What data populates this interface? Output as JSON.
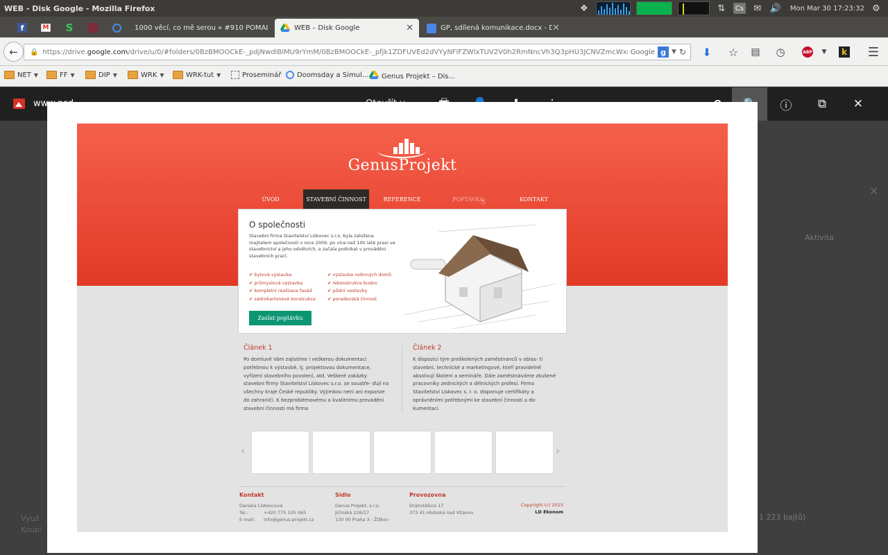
{
  "os_bar": {
    "window_title": "WEB - Disk Google - Mozilla Firefox",
    "clock": "Mon Mar 30 17:23:32",
    "cs_label": "Cs"
  },
  "tabs": [
    {
      "label": "1000 věcí, co mě serou » #910 POMALÁ ..."
    },
    {
      "label": "WEB – Disk Google"
    },
    {
      "label": "GP, sdílená komunikace.docx - Do..."
    }
  ],
  "url": {
    "prefix": "https://drive.",
    "domain": "google.com",
    "rest": "/drive/u/0/#folders/0BzBMOOCkE-_pdjNwdlBIMU9rYmM/0BzBMOOCkE-_pfjk1ZDFUVEd2dVYyNFlFZWlxTUV2V0h2RmNncVh3Q3pHU3JCNVZmcWxrR2s/0B9dngUYRv1HARV",
    "search_engine": "Google"
  },
  "bookmarks": [
    {
      "label": "NET",
      "type": "folder"
    },
    {
      "label": "FF",
      "type": "folder"
    },
    {
      "label": "DIP",
      "type": "folder"
    },
    {
      "label": "WRK",
      "type": "folder"
    },
    {
      "label": "WRK-tut",
      "type": "folder"
    },
    {
      "label": "Proseminář",
      "type": "page"
    },
    {
      "label": "Doomsday a Simul...",
      "type": "page"
    },
    {
      "label": "Genus Projekt – Dis...",
      "type": "page"
    }
  ],
  "viewer": {
    "file_name": "www.psd",
    "open_with": "Otevřít v",
    "zoom_fraction": 0.92
  },
  "drive_background": {
    "activity": "Aktivita",
    "size_note": "1 223 bajtů)",
    "left1": "Využ",
    "left2": "Koupi"
  },
  "site": {
    "logo": "GenusProjekt",
    "nav": [
      "ÚVOD",
      "STAVEBNÍ ČINNOST",
      "REFERENCE",
      "POPTÁVKA",
      "KONTAKT"
    ],
    "card": {
      "title": "O společnosti",
      "text": "Stavební firma Stavitelství Lískovec s.r.o. byla založena majitelem společnosti v roce 2009, po více než 10ti leté praxi ve stavebnictví a jeho odvětvích, a začala podnikat v provádění stavebních prací.",
      "list_left": [
        "bytová výstavba",
        "průmyslová výstavba",
        "kompletní realizace fasád",
        "sádrokartonové konstrukce"
      ],
      "list_right": [
        "výstavba rodinných domů",
        "rekonstrukce budov",
        "půdní vestavby",
        "poradenská činnost"
      ],
      "button": "Zaslat poptávku"
    },
    "article1": {
      "title": "Článek 1",
      "text": "Po domluvě Vám zajistíme i veškerou dokumentaci potřebnou k výstavbě, tj. projektovou dokumentace, vyřízení stavebního povolení, atd. Veškeré zakázky stavební firmy Stavitelství Lískovec s.r.o. se soustře- ďují na všechny kraje České republiky. Výjimkou není ani expanze do zahraničí. K bezproblémovému a kvalitnímu provádění stavební činnosti má firma"
    },
    "article2": {
      "title": "Článek 2",
      "text": "K dispozici tým proškolených zaměstnanců v oblas- ti stavební, technické a marketingové, kteří pravidelně absolvují školení a semináře. Dále zaměstnáváme zkušené pracovníky zednických a dělnických profesí. Firma Stavitelství Lískovec s. r. o. disponuje certifikáty a oprávněními potřebnými ke stavební činnosti a do- kumentaci."
    },
    "footer": {
      "contact_title": "Kontakt",
      "contact_name": "Daniela Lískovcová",
      "tel_label": "Tel.:",
      "tel": "+420 775 105 065",
      "email_label": "E-mail:",
      "email": "info@genus-projekt.cz",
      "seat_title": "Sídlo",
      "seat_lines": [
        "Genus Projekt, s.r.o.",
        "Jičínská 226/17",
        "130 00  Praha 3 - Žižkov"
      ],
      "op_title": "Provozovna",
      "op_lines": [
        "Drahotěšice 17",
        "373 41  Hluboká nad Vltavou"
      ],
      "copyright": "Copyright (c) 2015",
      "author": "LD Ekonom"
    }
  },
  "colors": {
    "accent_red": "#e13a27",
    "button_green": "#0d9673",
    "viewer_bar": "#1c1c1c"
  }
}
